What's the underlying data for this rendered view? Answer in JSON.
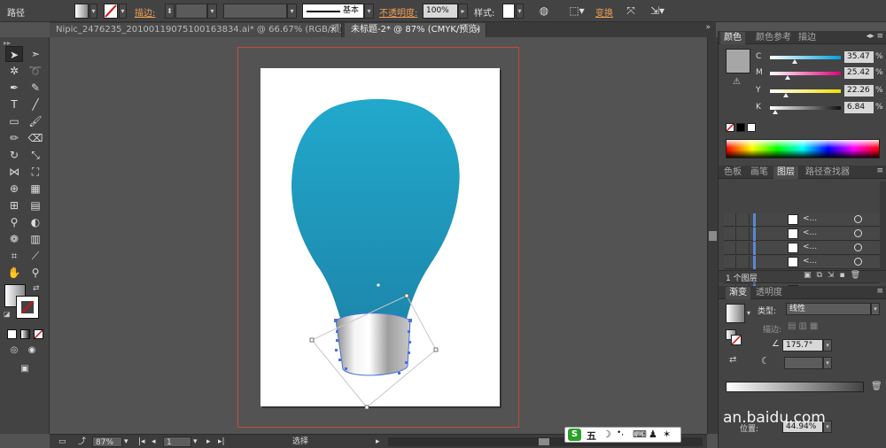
{
  "control_bar": {
    "object_type": "路径",
    "stroke_label": "描边:",
    "stroke_profile": "基本",
    "opacity_label": "不透明度:",
    "opacity_value": "100%",
    "style_label": "样式:",
    "transform_label": "变换"
  },
  "tabs": [
    {
      "label": "Nipic_2476235_20100119075100163834.ai* @ 66.67% (RGB/预览)",
      "active": false
    },
    {
      "label": "未标题-2* @ 87% (CMYK/预览)",
      "active": true
    }
  ],
  "color_panel": {
    "tabs": [
      "颜色",
      "颜色参考",
      "描边"
    ],
    "channels": [
      {
        "name": "C",
        "value": "35.47",
        "position": 0.35,
        "gradient": "linear-gradient(90deg,#fff,#00a0e0)"
      },
      {
        "name": "M",
        "value": "25.42",
        "position": 0.25,
        "gradient": "linear-gradient(90deg,#fff,#e0007a)"
      },
      {
        "name": "Y",
        "value": "22.26",
        "position": 0.22,
        "gradient": "linear-gradient(90deg,#fff,#f0e000)"
      },
      {
        "name": "K",
        "value": "6.84",
        "position": 0.07,
        "gradient": "linear-gradient(90deg,#fff,#111)"
      }
    ],
    "percent": "%",
    "current_fill": "#a6a6a6"
  },
  "layers_panel": {
    "tabs": [
      "色板",
      "画笔",
      "图层",
      "路径查找器"
    ],
    "active_tab": "图层",
    "rows": [
      "<...",
      "<...",
      "<...",
      "<...",
      "<...",
      "<..."
    ],
    "layer_count": "1 个图层"
  },
  "gradient_panel": {
    "tabs": [
      "渐变",
      "透明度"
    ],
    "type_label": "类型:",
    "type_value": "线性",
    "stroke_label": "描边:",
    "angle_value": "175.7°",
    "location_label": "位置:",
    "location_value": "44.94%"
  },
  "status_bar": {
    "zoom": "87%",
    "page": "1",
    "tool": "选择"
  },
  "ime": {
    "mode": "五"
  },
  "watermark": "an.baidu.com",
  "colors": {
    "bulb_top": "#21a9cc",
    "bulb_bottom": "#1d87ac",
    "bleed": "#c44b3d",
    "selection": "#4a72d9",
    "orange_label": "#f0a050"
  }
}
